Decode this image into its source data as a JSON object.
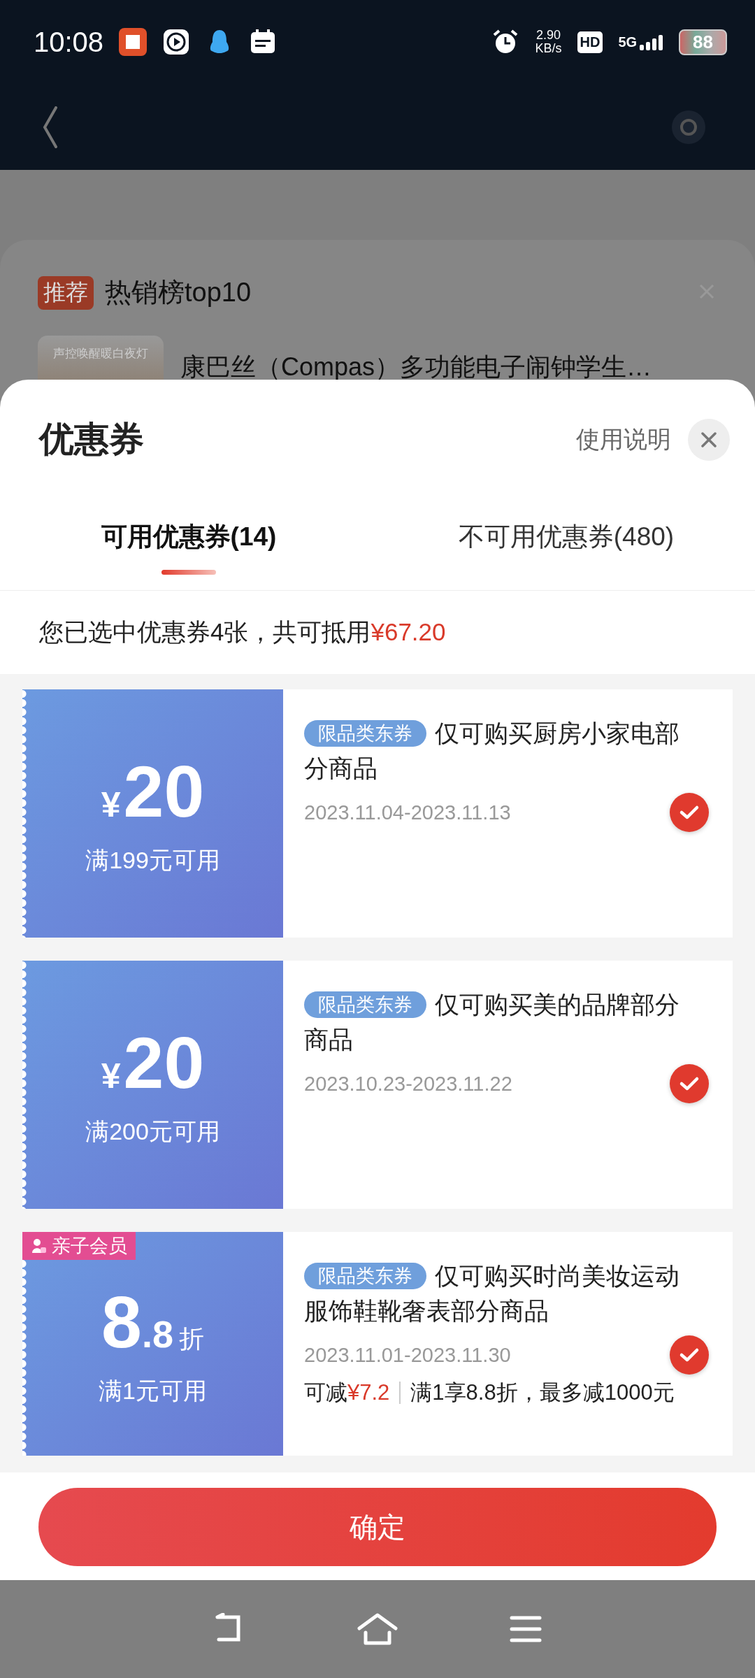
{
  "status_bar": {
    "time": "10:08",
    "speed_value": "2.90",
    "speed_unit": "KB/s",
    "hd": "HD",
    "network": "5G",
    "battery": "88"
  },
  "background_card": {
    "badge": "推荐",
    "title": "热销榜top10",
    "product_image_text": "声控唤醒暖白夜灯",
    "product_title": "康巴丝（Compas）多功能电子闹钟学生…"
  },
  "sheet": {
    "title": "优惠券",
    "help_link": "使用说明",
    "tabs": [
      {
        "label": "可用优惠券(14)",
        "selected": true
      },
      {
        "label": "不可用优惠券(480)",
        "selected": false
      }
    ],
    "summary": {
      "text": "您已选中优惠券4张，共可抵用",
      "amount": "¥67.20"
    },
    "coupons": [
      {
        "kind": "cash",
        "currency": "¥",
        "amount": "20",
        "condition": "满199元可用",
        "tag": "限品类东券",
        "title": "仅可购买厨房小家电部分商品",
        "dates": "2023.11.04-2023.11.13",
        "selected": true
      },
      {
        "kind": "cash",
        "currency": "¥",
        "amount": "20",
        "condition": "满200元可用",
        "tag": "限品类东券",
        "title": "仅可购买美的品牌部分商品",
        "dates": "2023.10.23-2023.11.22",
        "selected": true
      },
      {
        "kind": "discount",
        "ribbon": "亲子会员",
        "amount_major": "8",
        "amount_minor": ".8",
        "unit": "折",
        "condition": "满1元可用",
        "tag": "限品类东券",
        "title": "仅可购买时尚美妆运动服饰鞋靴奢表部分商品",
        "dates": "2023.11.01-2023.11.30",
        "selected": true,
        "save_label": "可减",
        "save_amount": "¥7.2",
        "rule": "满1享8.8折，最多减1000元"
      }
    ],
    "confirm_button": "确定"
  }
}
